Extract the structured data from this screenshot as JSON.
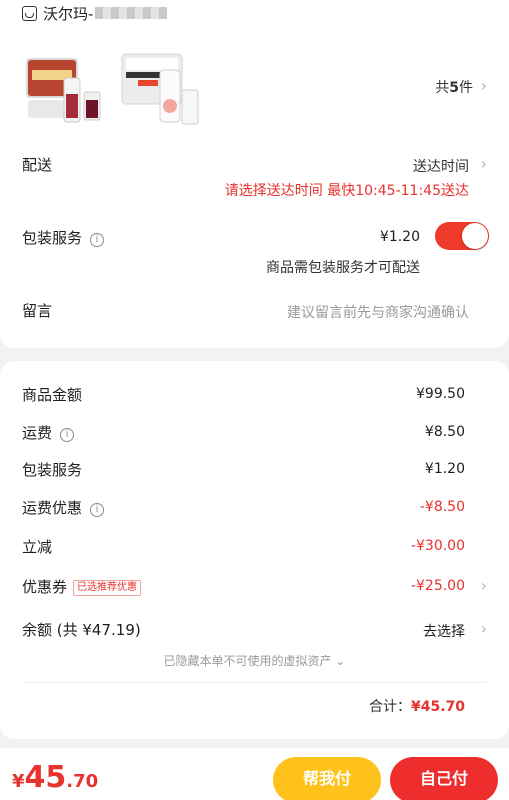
{
  "store": {
    "name": "沃尔玛-"
  },
  "items": {
    "count_prefix": "共",
    "count": "5",
    "count_suffix": "件"
  },
  "delivery": {
    "label": "配送",
    "time_label": "送达时间",
    "hint": "请选择送达时间  最快10:45-11:45送达"
  },
  "packaging": {
    "label": "包装服务",
    "price": "¥1.20",
    "toggle_on": true,
    "note": "商品需包装服务才可配送"
  },
  "message": {
    "label": "留言",
    "placeholder": "建议留言前先与商家沟通确认"
  },
  "summary": {
    "rows": [
      {
        "label": "商品金额",
        "value": "¥99.50"
      },
      {
        "label": "运费",
        "value": "¥8.50"
      },
      {
        "label": "包装服务",
        "value": "¥1.20"
      },
      {
        "label": "运费优惠",
        "value": "-¥8.50"
      },
      {
        "label": "立减",
        "value": "-¥30.00"
      },
      {
        "label": "优惠券",
        "badge": "已选推荐优惠",
        "value": "-¥25.00"
      },
      {
        "label": "余额 (共 ¥47.19)",
        "value": "去选择"
      }
    ],
    "hidden_assets": "已隐藏本单不可使用的虚拟资产",
    "total_label": "合计：",
    "total_value": "¥45.70"
  },
  "bottom": {
    "currency": "¥",
    "price_int": "45",
    "price_dec": ".70",
    "help_pay": "帮我付",
    "self_pay": "自己付"
  },
  "colors": {
    "accent_red": "#e8322d",
    "toggle_red": "#ee3b2c",
    "button_yellow": "#ffc21a"
  },
  "icons": [
    "store-icon",
    "info-icon",
    "chevron-right-icon",
    "chevron-down-icon"
  ]
}
